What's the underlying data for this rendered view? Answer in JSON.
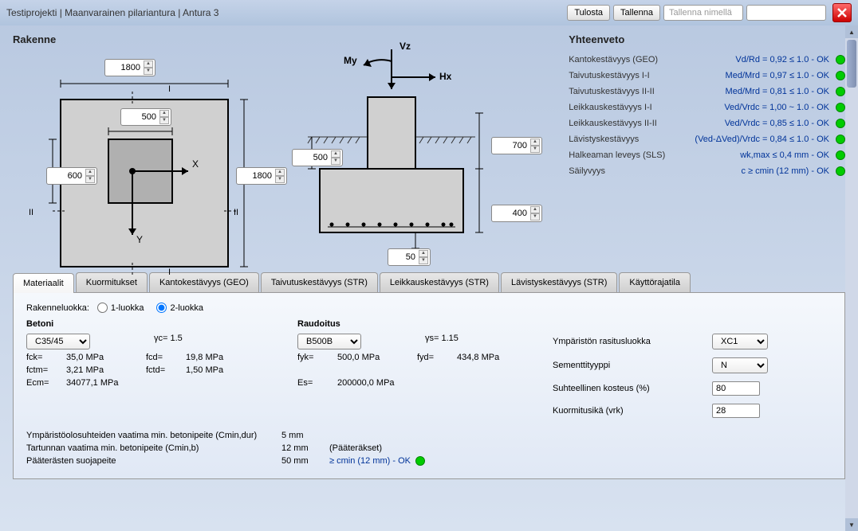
{
  "titlebar": {
    "text": "Testiprojekti | Maanvarainen pilariantura | Antura 3",
    "print": "Tulosta",
    "save": "Tallenna",
    "saveas_placeholder": "Tallenna nimellä"
  },
  "sections": {
    "rakenne": "Rakenne",
    "yhteenveto": "Yhteenveto"
  },
  "diagram1": {
    "top": "1800",
    "right": "1800",
    "inner_top": "500",
    "inner_left": "600",
    "x_label": "X",
    "y_label": "Y",
    "i_top": "I",
    "i_bottom": "I",
    "ii_left": "II",
    "ii_right": "II"
  },
  "diagram2": {
    "vz": "Vz",
    "my": "My",
    "hx": "Hx",
    "left": "500",
    "height_total": "700",
    "height_base": "400",
    "offset": "50"
  },
  "summary": [
    {
      "label": "Kantokestävyys (GEO)",
      "value": "Vd/Rd = 0,92 ≤ 1.0 - OK"
    },
    {
      "label": "Taivutuskestävyys I-I",
      "value": "Med/Mrd = 0,97 ≤ 1.0 - OK"
    },
    {
      "label": "Taivutuskestävyys II-II",
      "value": "Med/Mrd = 0,81 ≤ 1.0 - OK"
    },
    {
      "label": "Leikkauskestävyys I-I",
      "value": "Ved/Vrdc = 1,00  ~ 1.0 - OK"
    },
    {
      "label": "Leikkauskestävyys II-II",
      "value": "Ved/Vrdc = 0,85 ≤ 1.0 - OK"
    },
    {
      "label": "Lävistyskestävyys",
      "value": "(Ved-ΔVed)/Vrdc = 0,84 ≤ 1.0 - OK"
    },
    {
      "label": "Halkeaman leveys (SLS)",
      "value": "wk,max ≤ 0,4 mm - OK"
    },
    {
      "label": "Säilyvyys",
      "value": "c ≥ cmin (12 mm) - OK"
    }
  ],
  "tabs": [
    "Materiaalit",
    "Kuormitukset",
    "Kantokestävyys (GEO)",
    "Taivutuskestävyys (STR)",
    "Leikkauskestävyys (STR)",
    "Lävistyskestävyys (STR)",
    "Käyttörajatila"
  ],
  "materials": {
    "rakenneluokka_label": "Rakenneluokka:",
    "luokka1": "1-luokka",
    "luokka2": "2-luokka",
    "betoni_title": "Betoni",
    "raudoitus_title": "Raudoitus",
    "concrete_grade": "C35/45",
    "yc_lbl": "γc=",
    "yc": "1.5",
    "fck_lbl": "fck=",
    "fck": "35,0 MPa",
    "fcd_lbl": "fcd=",
    "fcd": "19,8 MPa",
    "fctm_lbl": "fctm=",
    "fctm": "3,21 MPa",
    "fctd_lbl": "fctd=",
    "fctd": "1,50 MPa",
    "ecm_lbl": "Ecm=",
    "ecm": "34077,1 MPa",
    "steel_grade": "B500B",
    "ys_lbl": "γs=",
    "ys": "1.15",
    "fyk_lbl": "fyk=",
    "fyk": "500,0 MPa",
    "fyd_lbl": "fyd=",
    "fyd": "434,8 MPa",
    "es_lbl": "Es=",
    "es": "200000,0 MPa",
    "cmin_dur_label": "Ympäristöolosuhteiden vaatima min. betonipeite (Cmin,dur)",
    "cmin_dur": "5 mm",
    "cmin_b_label": "Tartunnan vaatima min. betonipeite (Cmin,b)",
    "cmin_b": "12 mm",
    "cmin_b_note": "(Pääteräkset)",
    "cover_label": "Pääterästen suojapeite",
    "cover": "50 mm",
    "cover_ok": "≥ cmin (12 mm) - OK",
    "env_class_label": "Ympäristön rasitusluokka",
    "env_class": "XC1",
    "cement_label": "Sementtityyppi",
    "cement": "N",
    "humidity_label": "Suhteellinen kosteus (%)",
    "humidity": "80",
    "load_age_label": "Kuormitusikä (vrk)",
    "load_age": "28"
  }
}
